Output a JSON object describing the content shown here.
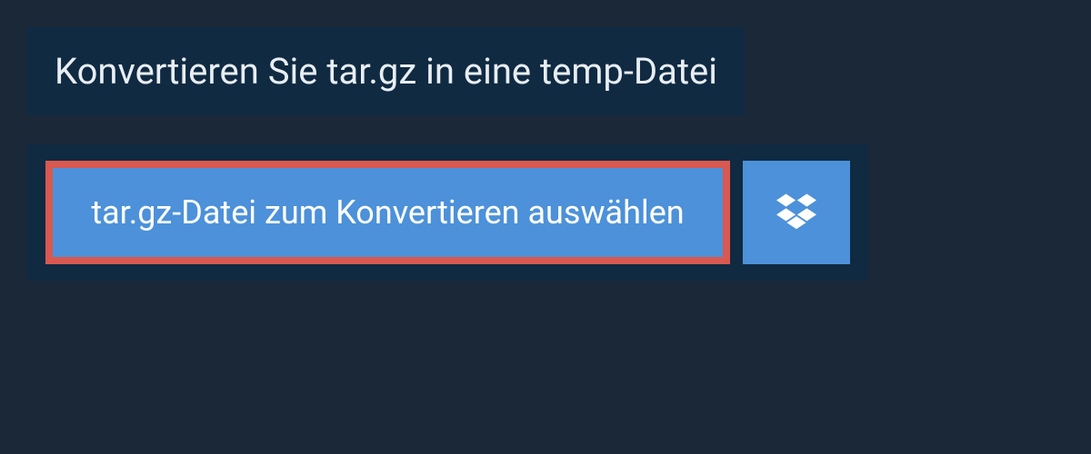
{
  "header": {
    "title": "Konvertieren Sie tar.gz in eine temp-Datei"
  },
  "upload": {
    "select_button_label": "tar.gz-Datei zum Konvertieren auswählen",
    "dropbox_icon": "dropbox"
  },
  "colors": {
    "background": "#1a2838",
    "panel": "#102a42",
    "button": "#4c91d9",
    "button_border": "#d95850",
    "text": "#ffffff"
  }
}
